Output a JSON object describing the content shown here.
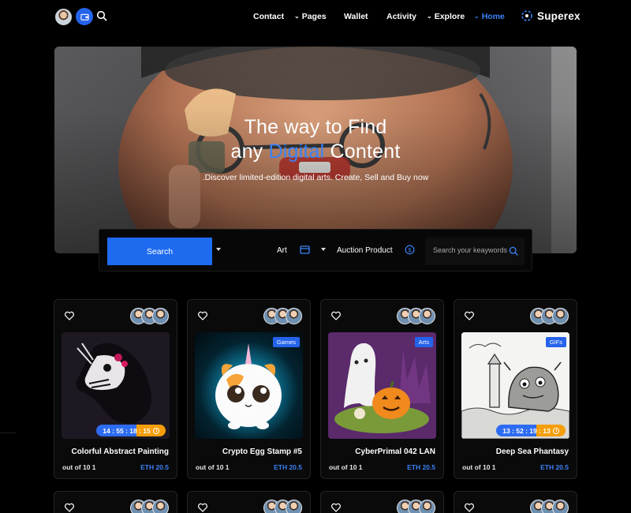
{
  "header": {
    "brand": "Superex",
    "nav": [
      {
        "label": "Contact",
        "has_menu": false,
        "active": false
      },
      {
        "label": "Pages",
        "has_menu": true,
        "active": false
      },
      {
        "label": "Wallet",
        "has_menu": false,
        "active": false
      },
      {
        "label": "Activity",
        "has_menu": false,
        "active": false
      },
      {
        "label": "Explore",
        "has_menu": true,
        "active": false
      },
      {
        "label": "Home",
        "has_menu": true,
        "active": true
      }
    ],
    "icons": {
      "wallet": "wallet-icon",
      "search": "search-icon",
      "avatar": "user-avatar"
    }
  },
  "hero": {
    "title_line1": "The way to Find",
    "title_line2_before": "any ",
    "title_line2_accent": "Digital",
    "title_line2_after": " Content",
    "subtitle": ".Discover limited-edition digital arts. Create, Sell and Buy now"
  },
  "search": {
    "button_label": "Search",
    "category_value": "Art",
    "type_value": "Auction Product",
    "keyword_placeholder": "Search your keaywords",
    "icons": {
      "category": "browser-window-icon",
      "type": "dollar-circle-icon",
      "submit": "search-icon"
    }
  },
  "cards": [
    {
      "title": "Colorful Abstract Painting",
      "supply": "out of 10 1",
      "price": "ETH 20.5",
      "badge": "",
      "timer": "14 : 55 : 18 : 15"
    },
    {
      "title": "Crypto Egg Stamp #5",
      "supply": "out of 10 1",
      "price": "ETH 20.5",
      "badge": "Games",
      "timer": ""
    },
    {
      "title": "CyberPrimal 042 LAN",
      "supply": "out of 10 1",
      "price": "ETH 20.5",
      "badge": "Arts",
      "timer": ""
    },
    {
      "title": "Deep Sea Phantasy",
      "supply": "out of 10 1",
      "price": "ETH 20.5",
      "badge": "GIFs",
      "timer": "13 : 52 : 19 : 13"
    }
  ],
  "colors": {
    "accent": "#2563eb",
    "link": "#3b82f6",
    "timer_end": "#f59e0b",
    "background": "#000000"
  }
}
